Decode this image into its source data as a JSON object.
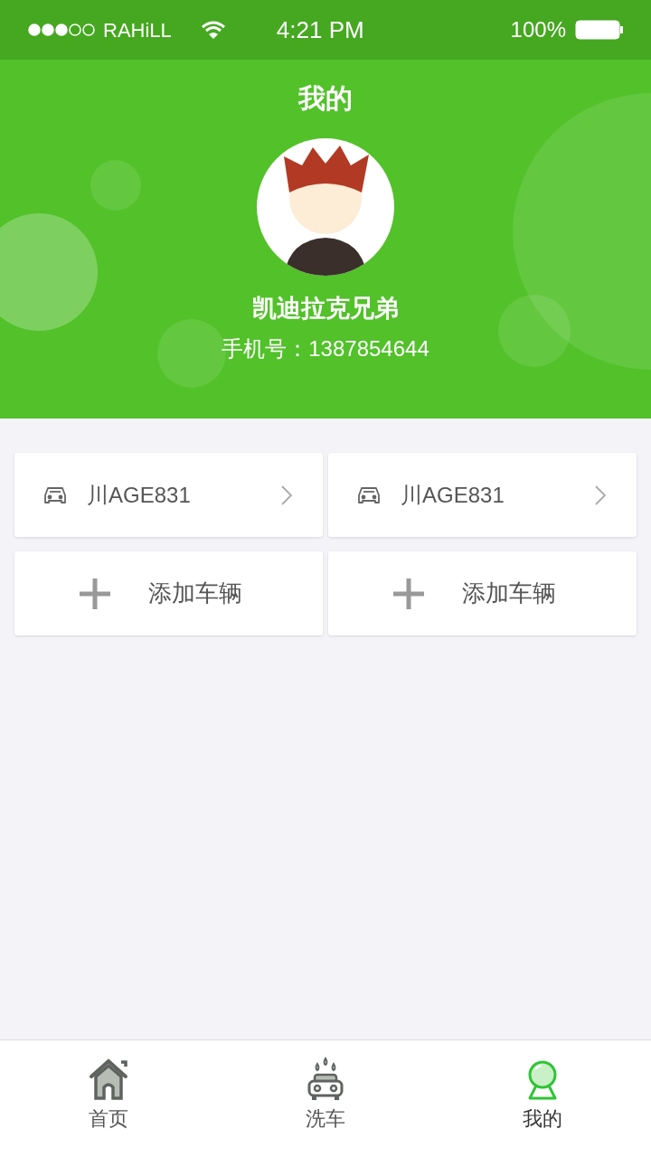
{
  "status_bar": {
    "carrier": "RAHiLL",
    "time": "4:21 PM",
    "battery": "100%"
  },
  "header": {
    "title": "我的",
    "name": "凯迪拉克兄弟",
    "phone": "手机号：1387854644"
  },
  "cards": [
    {
      "kind": "vehicle",
      "label": "川AGE831"
    },
    {
      "kind": "vehicle",
      "label": "川AGE831"
    },
    {
      "kind": "add",
      "label": "添加车辆"
    },
    {
      "kind": "add",
      "label": "添加车辆"
    }
  ],
  "tab_bar": [
    {
      "kind": "home",
      "label": "首页",
      "selected": false
    },
    {
      "kind": "wash",
      "label": "洗车",
      "selected": false
    },
    {
      "kind": "me",
      "label": "我的",
      "selected": true
    }
  ]
}
